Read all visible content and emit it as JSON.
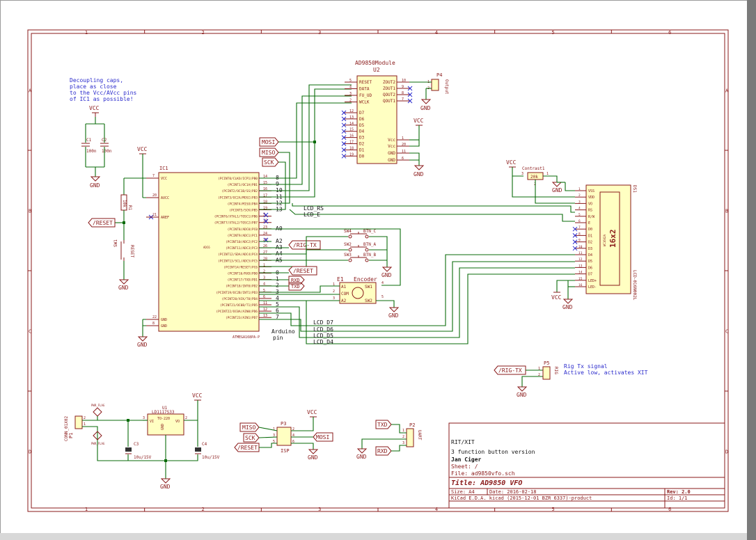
{
  "frame": {
    "columns": [
      "1",
      "2",
      "3",
      "4",
      "5",
      "6"
    ],
    "rows": [
      "A",
      "B",
      "C",
      "D"
    ]
  },
  "notes": {
    "decoupling": [
      "Decoupling caps,",
      "place as close",
      "to the Vcc/AVcc pins",
      "of IC1 as possible!"
    ],
    "rig_tx": [
      "Rig Tx signal",
      "Active low, activates XIT"
    ],
    "arduino": [
      "Arduino",
      "pin"
    ]
  },
  "power": {
    "vcc": "VCC",
    "gnd": "GND",
    "pwr_flag": "PWR_FLAG"
  },
  "u2": {
    "ref": "U2",
    "value": "AD9850Module",
    "left_pins": [
      {
        "num": "5",
        "name": "RESET"
      },
      {
        "num": "4",
        "name": "DATA"
      },
      {
        "num": "3",
        "name": "FU_UD"
      },
      {
        "num": "2",
        "name": "WCLK"
      },
      {
        "num": "12",
        "name": "D7"
      },
      {
        "num": "13",
        "name": "D6"
      },
      {
        "num": "14",
        "name": "D5"
      },
      {
        "num": "15",
        "name": "D4"
      },
      {
        "num": "16",
        "name": "D3"
      },
      {
        "num": "17",
        "name": "D2"
      },
      {
        "num": "18",
        "name": "D1"
      },
      {
        "num": "19",
        "name": "D0"
      }
    ],
    "right_pins": [
      {
        "num": "10",
        "name": "ZOUT2"
      },
      {
        "num": "9",
        "name": "ZOUT1"
      },
      {
        "num": "8",
        "name": "QOUT2"
      },
      {
        "num": "7",
        "name": "QOUT1"
      },
      {
        "num": "1",
        "name": "Vcc"
      },
      {
        "num": "20",
        "name": "Vcc"
      },
      {
        "num": "11",
        "name": "GND"
      },
      {
        "num": "6",
        "name": "GND"
      }
    ]
  },
  "p4": {
    "ref": "P4",
    "value": "Output",
    "pins": [
      "1",
      "2"
    ]
  },
  "ic1": {
    "ref": "IC1",
    "value": "ATMEGA168PA-P",
    "left_pins": [
      {
        "num": "7",
        "name": "VCC"
      },
      {
        "num": "20",
        "name": "AVCC"
      },
      {
        "num": "21",
        "name": "AREF"
      },
      {
        "num": "22",
        "name": "GND"
      },
      {
        "num": "8",
        "name": "GND"
      }
    ],
    "right_pins": [
      {
        "num": "14",
        "name": "(PCINT0/CLKO/ICP1)PB0",
        "ard": "8"
      },
      {
        "num": "15",
        "name": "(PCINT1/OC1A)PB1",
        "ard": "9"
      },
      {
        "num": "16",
        "name": "(PCINT2/OC1B/SS)PB2",
        "ard": "10"
      },
      {
        "num": "17",
        "name": "(PCINT3/OC2A/MOSI)PB3",
        "ard": "11"
      },
      {
        "num": "18",
        "name": "(PCINT4/MISO)PB4",
        "ard": "12"
      },
      {
        "num": "19",
        "name": "(PCINT5/SCK)PB5",
        "ard": "13"
      },
      {
        "num": "9",
        "name": "(PCINT6/XTAL1/TOSC1)PB6",
        "ard": ""
      },
      {
        "num": "10",
        "name": "(PCINT7/XTAL2/TOSC2)PB7",
        "ard": ""
      },
      {
        "num": "23",
        "name": "(PCINT8/ADC0)PC0",
        "ard": "A0"
      },
      {
        "num": "24",
        "name": "(PCINT9/ADC1)PC1",
        "ard": ""
      },
      {
        "num": "25",
        "name": "(PCINT10/ADC2)PC2",
        "ard": "A2"
      },
      {
        "num": "26",
        "name": "(PCINT11/ADC3)PC3",
        "ard": "A3"
      },
      {
        "num": "27",
        "name": "(PCINT12/SDA/ADC4)PC4",
        "ard": "A4"
      },
      {
        "num": "28",
        "name": "(PCINT13/SCL/ADC5)PC5",
        "ard": "A5"
      },
      {
        "num": "1",
        "name": "(PCINT14/RESET)PC6",
        "ard": ""
      },
      {
        "num": "2",
        "name": "(PCINT16/RXD)PD0",
        "ard": "0"
      },
      {
        "num": "3",
        "name": "(PCINT17/TXD)PD1",
        "ard": "1"
      },
      {
        "num": "4",
        "name": "(PCINT18/INT0)PD2",
        "ard": "2"
      },
      {
        "num": "5",
        "name": "(PCINT19/OC2B/INT1)PD3",
        "ard": "3"
      },
      {
        "num": "6",
        "name": "(PCINT20/XCK/T0)PD4",
        "ard": "4"
      },
      {
        "num": "11",
        "name": "(PCINT21/OC0B/T1)PD5",
        "ard": "5"
      },
      {
        "num": "12",
        "name": "(PCINT22/OC0A/AIN0)PD6",
        "ard": "6"
      },
      {
        "num": "13",
        "name": "(PCINT23/AIN1)PD7",
        "ard": "7"
      }
    ],
    "adc_note": "ADC6"
  },
  "caps": {
    "c1": {
      "ref": "C1",
      "value": "100n"
    },
    "c2": {
      "ref": "C2",
      "value": "100n"
    },
    "c3": {
      "ref": "C3",
      "value": "10u/15V"
    },
    "c4": {
      "ref": "C4",
      "value": "10u/15V"
    }
  },
  "r1": {
    "ref": "R1",
    "value": "10k"
  },
  "sw1": {
    "ref": "SW1",
    "value": "RESET"
  },
  "switches": [
    {
      "ref": "SW4",
      "value": "BTN_C"
    },
    {
      "ref": "SW2",
      "value": "BTN_A"
    },
    {
      "ref": "SW3",
      "value": "BTN_B"
    }
  ],
  "encoder": {
    "ref": "E1",
    "value": "Encoder",
    "pins": [
      {
        "num": "1",
        "name": "A1"
      },
      {
        "num": "2",
        "name": "COM"
      },
      {
        "num": "3",
        "name": "A2"
      },
      {
        "num": "4",
        "name": "SW1"
      },
      {
        "num": "5",
        "name": "SW2"
      }
    ]
  },
  "contrast": {
    "ref": "Contrast1",
    "value": "20k",
    "pins": [
      "3",
      "2",
      "1"
    ]
  },
  "lcd": {
    "ref": "DS1",
    "value": "LCD-016N002L",
    "label": "16x2",
    "maker": "WC1602A",
    "pins": [
      {
        "num": "1",
        "name": "VSS"
      },
      {
        "num": "2",
        "name": "VDD"
      },
      {
        "num": "3",
        "name": "VO"
      },
      {
        "num": "4",
        "name": "RS"
      },
      {
        "num": "5",
        "name": "R/W"
      },
      {
        "num": "6",
        "name": "E"
      },
      {
        "num": "7",
        "name": "D0"
      },
      {
        "num": "8",
        "name": "D1"
      },
      {
        "num": "9",
        "name": "D2"
      },
      {
        "num": "10",
        "name": "D3"
      },
      {
        "num": "11",
        "name": "D4"
      },
      {
        "num": "12",
        "name": "D5"
      },
      {
        "num": "13",
        "name": "D6"
      },
      {
        "num": "14",
        "name": "D7"
      },
      {
        "num": "15",
        "name": "LED+"
      },
      {
        "num": "16",
        "name": "LED-"
      }
    ]
  },
  "labels": {
    "mosi": "MOSI",
    "miso": "MISO",
    "sck": "SCK",
    "reset": "/RESET",
    "rig_tx": "/RIG-TX",
    "rxd": "RXD",
    "txd": "TXD"
  },
  "nets": {
    "lcd_rs": "LCD_RS",
    "lcd_e": "LCD_E",
    "lcd_d7": "LCD_D7",
    "lcd_d6": "LCD_D6",
    "lcd_d5": "LCD_D5",
    "lcd_d4": "LCD_D4"
  },
  "p5": {
    "ref": "P5",
    "value": "RIG",
    "pins": [
      "1",
      "2"
    ]
  },
  "p1": {
    "ref": "P1",
    "value": "CONN_01X02",
    "pins": [
      "1",
      "2"
    ]
  },
  "u1": {
    "ref": "U1",
    "value": "LD1117S33",
    "package": "TO-220",
    "pins": [
      {
        "num": "3",
        "name": "VI"
      },
      {
        "num": "2",
        "name": "VO"
      },
      {
        "num": "1",
        "name": "GND"
      }
    ]
  },
  "p3": {
    "ref": "P3",
    "value": "ISP",
    "pins": [
      "1",
      "2",
      "3",
      "4",
      "5",
      "6"
    ]
  },
  "p2": {
    "ref": "P2",
    "value": "UART",
    "pins": [
      "1",
      "2",
      "3"
    ]
  },
  "title_block": {
    "notes": [
      "RIT/XIT",
      "3 function button version",
      "Jan Ciger"
    ],
    "sheet": "Sheet: /",
    "file": "File: ad9850vfo.sch",
    "title": "Title: AD9850 VFO",
    "size": "Size: A4",
    "date": "Date: 2016-02-18",
    "rev": "Rev: 2.0",
    "tool": "KiCad E.D.A.  kicad (2015-12-01 BZR 6337)-product",
    "id": "Id: 1/1"
  }
}
